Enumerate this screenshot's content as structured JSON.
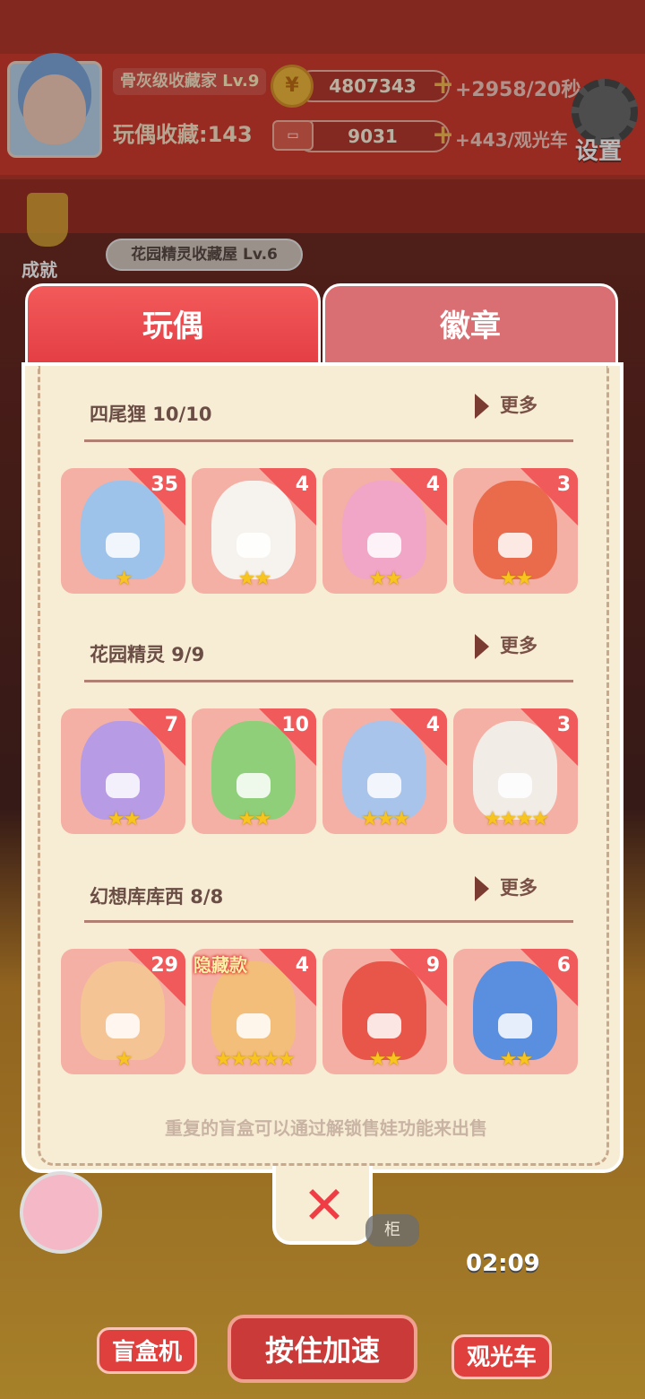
{
  "hud": {
    "rank_title": "骨灰级收藏家",
    "rank_level": "Lv.9",
    "collection_label": "玩偶收藏:",
    "collection_count": "143",
    "coins": "4807343",
    "coin_rate": "+2958/20秒",
    "tickets": "9031",
    "ticket_rate": "+443/观光车",
    "settings_label": "设置",
    "coin_icon": "¥",
    "ticket_icon": "▭"
  },
  "side": {
    "achievement_label": "成就",
    "house_label": "花园精灵收藏屋 Lv.6"
  },
  "tabs": [
    {
      "label": "玩偶"
    },
    {
      "label": "徽章"
    }
  ],
  "sections": [
    {
      "title": "四尾狸 10/10",
      "more": "更多",
      "cards": [
        {
          "count": "35",
          "stars": "★",
          "color": "#9ec3ea"
        },
        {
          "count": "4",
          "stars": "★★",
          "color": "#f6f3ef"
        },
        {
          "count": "4",
          "stars": "★★",
          "color": "#f1a5c7"
        },
        {
          "count": "3",
          "stars": "★★",
          "color": "#ea6a4c"
        }
      ]
    },
    {
      "title": "花园精灵 9/9",
      "more": "更多",
      "cards": [
        {
          "count": "7",
          "stars": "★★",
          "color": "#b79be5"
        },
        {
          "count": "10",
          "stars": "★★",
          "color": "#8fcf79"
        },
        {
          "count": "4",
          "stars": "★★★",
          "color": "#a9c4ea"
        },
        {
          "count": "3",
          "stars": "★★★★",
          "color": "#f1ece6"
        }
      ]
    },
    {
      "title": "幻想库库西 8/8",
      "more": "更多",
      "hidden_tag": "隐藏款",
      "cards": [
        {
          "count": "29",
          "stars": "★",
          "color": "#f4c495"
        },
        {
          "count": "4",
          "stars": "★★★★★",
          "color": "#f3be7a"
        },
        {
          "count": "9",
          "stars": "★★",
          "color": "#e8564a"
        },
        {
          "count": "6",
          "stars": "★★",
          "color": "#5a8fe0"
        }
      ]
    }
  ],
  "footer_note": "重复的盲盒可以通过解锁售娃功能来出售",
  "close_label": "✕",
  "bottom": {
    "blindbox_label": "盲盒机",
    "press_label": "按住加速",
    "bus_label": "观光车",
    "timer": "02:09",
    "cabinet_label": "柜"
  }
}
